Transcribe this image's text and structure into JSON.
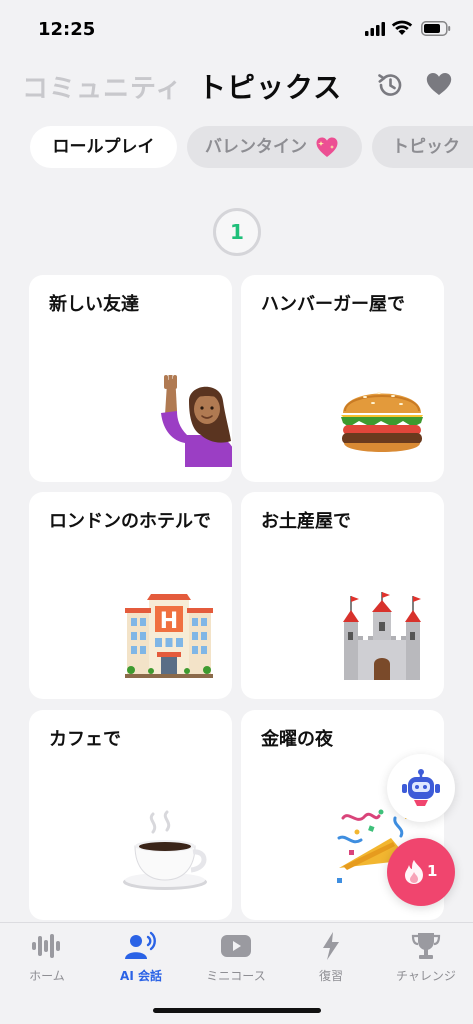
{
  "status_bar": {
    "time": "12:25"
  },
  "header": {
    "tab_community": "コミュニティ",
    "tab_topics": "トピックス"
  },
  "chips": [
    {
      "label": "ロールプレイ",
      "active": true
    },
    {
      "label": "バレンタイン",
      "active": false
    },
    {
      "label": "トピック",
      "active": false
    }
  ],
  "level": "1",
  "cards": [
    {
      "title": "新しい友達",
      "icon": "person-raising-hand-icon"
    },
    {
      "title": "ハンバーガー屋で",
      "icon": "hamburger-icon"
    },
    {
      "title": "ロンドンのホテルで",
      "icon": "hotel-icon"
    },
    {
      "title": "お土産屋で",
      "icon": "castle-icon"
    },
    {
      "title": "カフェで",
      "icon": "coffee-icon"
    },
    {
      "title": "金曜の夜",
      "icon": "party-popper-icon"
    }
  ],
  "streak_count": "1",
  "tabbar": {
    "items": [
      {
        "label": "ホーム",
        "icon": "waveform-icon",
        "active": false
      },
      {
        "label": "AI 会話",
        "icon": "speaking-person-icon",
        "active": true
      },
      {
        "label": "ミニコース",
        "icon": "play-icon",
        "active": false
      },
      {
        "label": "復習",
        "icon": "bolt-icon",
        "active": false
      },
      {
        "label": "チャレンジ",
        "icon": "trophy-icon",
        "active": false
      }
    ]
  },
  "colors": {
    "accent_blue": "#2b63e6",
    "level_green": "#1fbf7a",
    "streak_pink": "#f0456e"
  }
}
